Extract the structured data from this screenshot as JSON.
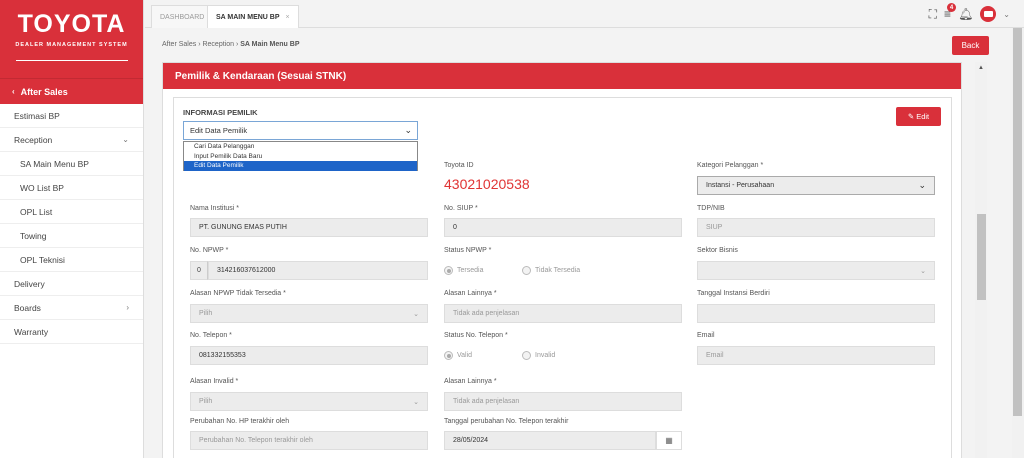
{
  "sidebar": {
    "brand": "TOYOTA",
    "brand_sub": "DEALER MANAGEMENT SYSTEM",
    "section": "After Sales",
    "items": [
      {
        "label": "Estimasi BP",
        "caret": ""
      },
      {
        "label": "Reception",
        "caret": "⌄"
      },
      {
        "label": "SA Main Menu BP",
        "caret": ""
      },
      {
        "label": "WO List BP",
        "caret": ""
      },
      {
        "label": "OPL List",
        "caret": ""
      },
      {
        "label": "Towing",
        "caret": ""
      },
      {
        "label": "OPL Teknisi",
        "caret": ""
      },
      {
        "label": "Delivery",
        "caret": ""
      },
      {
        "label": "Boards",
        "caret": "›"
      },
      {
        "label": "Warranty",
        "caret": ""
      }
    ]
  },
  "tabs": [
    {
      "label": "DASHBOARD"
    },
    {
      "label": "SA MAIN MENU BP",
      "close": "×"
    }
  ],
  "topbar": {
    "notif_count": "4"
  },
  "breadcrumb": {
    "part1": "After Sales",
    "sep": " › ",
    "part2": "Reception",
    "part3": "SA Main Menu BP"
  },
  "back_label": "Back",
  "panel_title": "Pemilik & Kendaraan (Sesuai STNK)",
  "section_title": "INFORMASI PEMILIK",
  "edit_label": "Edit",
  "select_value": "Edit Data Pemilik",
  "dropdown_options": [
    "Cari Data Pelanggan",
    "Input Pemilik Data Baru",
    "Edit Data Pemilik"
  ],
  "form": {
    "toyota_id_label": "Toyota ID",
    "toyota_id_value": "43021020538",
    "kategori_label": "Kategori Pelanggan *",
    "kategori_value": "Instansi - Perusahaan",
    "nama_label": "Nama Institusi *",
    "nama_value": "PT. GUNUNG EMAS PUTIH",
    "siup_label": "No. SIUP *",
    "siup_value": "0",
    "tdp_label": "TDP/NIB",
    "tdp_placeholder": "SIUP",
    "npwp_label": "No. NPWP *",
    "npwp_prefix": "0",
    "npwp_value": "314216037612000",
    "status_npwp_label": "Status NPWP *",
    "status_npwp_opt1": "Tersedia",
    "status_npwp_opt2": "Tidak Tersedia",
    "sektor_label": "Sektor Bisnis",
    "alasan_npwp_label": "Alasan NPWP Tidak Tersedia *",
    "alasan_npwp_placeholder": "Pilih",
    "alasan_lain1_label": "Alasan Lainnya *",
    "alasan_lain1_placeholder": "Tidak ada penjelasan",
    "tgl_instansi_label": "Tanggal Instansi Berdiri",
    "telp_label": "No. Telepon *",
    "telp_value": "081332155353",
    "status_telp_label": "Status No. Telepon *",
    "status_telp_opt1": "Valid",
    "status_telp_opt2": "Invalid",
    "email_label": "Email",
    "email_placeholder": "Email",
    "alasan_invalid_label": "Alasan Invalid *",
    "alasan_invalid_placeholder": "Pilih",
    "alasan_lain2_label": "Alasan Lainnya *",
    "alasan_lain2_placeholder": "Tidak ada penjelasan",
    "perubahan_hp_label": "Perubahan No. HP terakhir oleh",
    "perubahan_hp_placeholder": "Perubahan No. Telepon terakhir oleh",
    "tgl_perubahan_label": "Tanggal perubahan No. Telepon terakhir",
    "tgl_perubahan_value": "28/05/2024"
  }
}
